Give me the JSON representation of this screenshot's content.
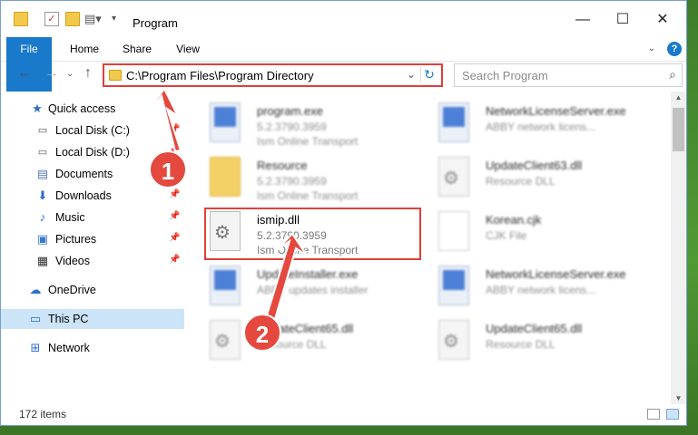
{
  "window": {
    "title": "Program",
    "controls": {
      "minimize": "—",
      "maximize": "☐",
      "close": "✕"
    }
  },
  "ribbon": {
    "tabs": [
      "File",
      "Home",
      "Share",
      "View"
    ]
  },
  "address": {
    "path": "C:\\Program Files\\Program Directory",
    "search_placeholder": "Search Program"
  },
  "sidebar": {
    "items": [
      {
        "label": "Quick access",
        "icon": "star-icon"
      },
      {
        "label": "Local Disk (C:)",
        "icon": "drive-icon",
        "pinned": true
      },
      {
        "label": "Local Disk (D:)",
        "icon": "drive-icon",
        "pinned": true
      },
      {
        "label": "Documents",
        "icon": "documents-icon",
        "pinned": true
      },
      {
        "label": "Downloads",
        "icon": "download-icon",
        "pinned": true
      },
      {
        "label": "Music",
        "icon": "music-icon",
        "pinned": true
      },
      {
        "label": "Pictures",
        "icon": "pictures-icon",
        "pinned": true
      },
      {
        "label": "Videos",
        "icon": "videos-icon",
        "pinned": true
      },
      {
        "label": "OneDrive",
        "icon": "cloud-icon"
      },
      {
        "label": "This PC",
        "icon": "computer-icon",
        "selected": true
      },
      {
        "label": "Network",
        "icon": "network-icon"
      }
    ]
  },
  "files": [
    {
      "name": "program.exe",
      "line2": "5.2.3790.3959",
      "line3": "Ism Online Transport",
      "type": "exe"
    },
    {
      "name": "NetworkLicenseServer.exe",
      "line2": "ABBY network licens...",
      "line3": "",
      "type": "exe"
    },
    {
      "name": "Resource",
      "line2": "5.2.3790.3959",
      "line3": "Ism Online Transport",
      "type": "folder"
    },
    {
      "name": "UpdateClient63.dll",
      "line2": "Resource DLL",
      "line3": "",
      "type": "dll"
    },
    {
      "name": "ismip.dll",
      "line2": "5.2.3790.3959",
      "line3": "Ism Online Transport",
      "type": "dll"
    },
    {
      "name": "Korean.cjk",
      "line2": "CJK File",
      "line3": "",
      "type": "cjk"
    },
    {
      "name": "UpdateInstaller.exe",
      "line2": "ABBY updates installer",
      "line3": "",
      "type": "exe"
    },
    {
      "name": "NetworkLicenseServer.exe",
      "line2": "ABBY network licens...",
      "line3": "",
      "type": "exe"
    },
    {
      "name": "UpdateClient65.dll",
      "line2": "Resource DLL",
      "line3": "",
      "type": "dll"
    },
    {
      "name": "UpdateClient65.dll",
      "line2": "Resource DLL",
      "line3": "",
      "type": "dll"
    }
  ],
  "status": {
    "item_count": "172 items"
  },
  "callouts": {
    "step1": "1",
    "step2": "2"
  },
  "colors": {
    "accent": "#1979ca",
    "callout": "#e5483e",
    "selected": "#cce4f7"
  }
}
